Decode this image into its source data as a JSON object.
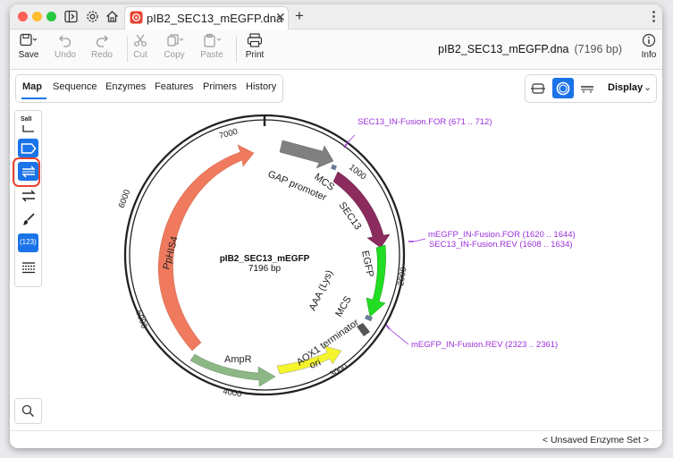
{
  "tab": {
    "title": "pIB2_SEC13_mEGFP.dna"
  },
  "toolbar": {
    "save": "Save",
    "undo": "Undo",
    "redo": "Redo",
    "cut": "Cut",
    "copy": "Copy",
    "paste": "Paste",
    "print": "Print",
    "info": "Info",
    "filename": "pIB2_SEC13_mEGFP.dna",
    "length": "(7196 bp)"
  },
  "nav": {
    "tabs": [
      "Map",
      "Sequence",
      "Enzymes",
      "Features",
      "Primers",
      "History"
    ]
  },
  "view": {
    "display": "Display"
  },
  "tools": {
    "sali": "SalI",
    "count": "(123)"
  },
  "map": {
    "name": "pIB2_SEC13_mEGFP",
    "size": "7196 bp",
    "ticks": [
      "1000",
      "2000",
      "3000",
      "4000",
      "5000",
      "6000",
      "7000"
    ],
    "features": {
      "gap": "GAP promoter",
      "mcs1": "MCS",
      "sec13": "SEC13",
      "egfp": "EGFP",
      "aaa": "AAA (Lys)",
      "mcs2": "MCS",
      "aox1": "AOX1 terminator",
      "ori": "ori",
      "ampr": "AmpR",
      "phis4": "PpHIS4"
    },
    "primers": {
      "p1": "SEC13_IN-Fusion.FOR  (671 .. 712)",
      "p2": "mEGFP_IN-Fusion.FOR  (1620 .. 1644)",
      "p3": "SEC13_IN-Fusion.REV  (1608 .. 1634)",
      "p4": "mEGFP_IN-Fusion.REV  (2323 .. 2361)"
    }
  },
  "status": {
    "enzyme_set": "< Unsaved Enzyme Set >"
  },
  "colors": {
    "accent": "#1a73e8",
    "primer": "#9b30d9",
    "highlight": "#e8432f"
  }
}
